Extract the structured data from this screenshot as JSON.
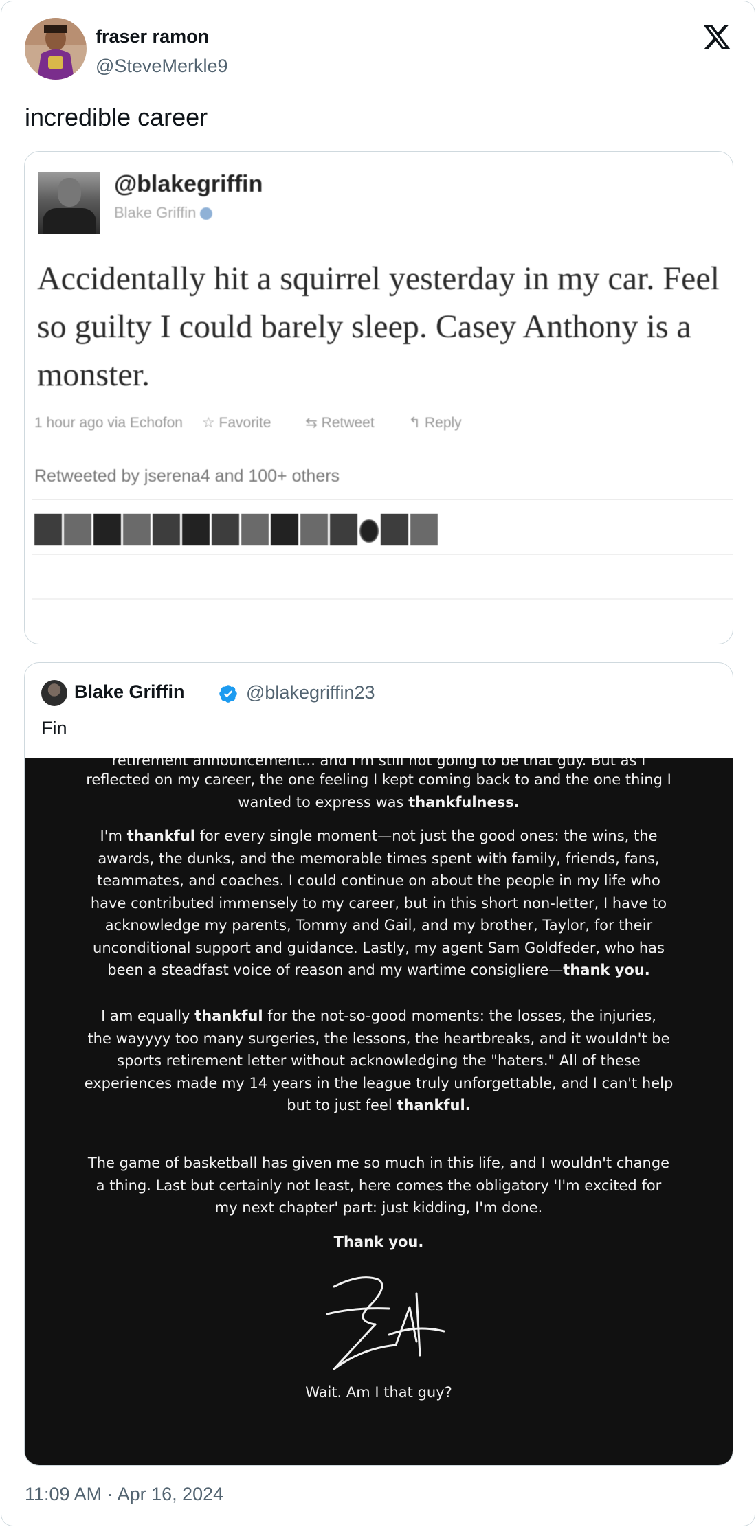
{
  "post": {
    "author_name": "fraser ramon",
    "author_handle": "@SteveMerkle9",
    "text": "incredible career",
    "timestamp": "11:09 AM · Apr 16, 2024"
  },
  "embedded_image": {
    "handle": "@blakegriffin",
    "name": "Blake Griffin",
    "text": "Accidentally hit a squirrel yesterday in my car. Feel so guilty I could barely sleep. Casey Anthony is a monster.",
    "meta_time": "1 hour ago via Echofon",
    "meta_favorite": "Favorite",
    "meta_retweet": "Retweet",
    "meta_reply": "Reply",
    "retweeted_by": "Retweeted by jserena4 and 100+ others"
  },
  "quote": {
    "name": "Blake Griffin",
    "handle": "@blakegriffin23",
    "text": "Fin"
  },
  "letter": {
    "cut_line": "retirement announcement... and I'm still not going to be that guy. But as I",
    "p1_a": "reflected on my career, the one feeling I kept coming back to and the one thing I",
    "p1_b": "wanted to express was ",
    "p1_bold": "thankfulness.",
    "p2_a": "I'm ",
    "p2_bold1": "thankful",
    "p2_b": " for every single moment—not just the good ones: the wins, the",
    "p2_c": "awards, the dunks, and the memorable times spent with family, friends, fans,",
    "p2_d": "teammates, and coaches. I could continue on about the people in my life who",
    "p2_e": "have contributed immensely to my career, but in this short non-letter, I have to",
    "p2_f": "acknowledge my parents, Tommy and Gail, and my brother, Taylor, for their",
    "p2_g": "unconditional support and guidance. Lastly, my agent Sam Goldfeder, who has",
    "p2_h": "been a steadfast voice of reason and my wartime consigliere—",
    "p2_bold2": "thank you.",
    "p3_a": "I am equally ",
    "p3_bold1": "thankful",
    "p3_b": " for the not-so-good moments: the losses, the injuries,",
    "p3_c": "the wayyyy too many surgeries, the lessons, the heartbreaks, and it wouldn't be",
    "p3_d": "sports retirement letter without acknowledging the \"haters.\" All of these",
    "p3_e": "experiences made my 14 years in the league truly unforgettable, and I can't help",
    "p3_f": "but to just feel ",
    "p3_bold2": "thankful.",
    "p4_a": "The game of basketball has given me so much in this life, and I wouldn't change",
    "p4_b": "a thing.  Last but certainly not least, here comes the obligatory 'I'm excited for",
    "p4_c": "my next chapter' part: just kidding, I'm done.",
    "p5": "Thank you.",
    "closing": "Wait. Am I that guy?"
  },
  "colors": {
    "text_primary": "#0f1419",
    "text_secondary": "#536471",
    "border": "#cfd9de",
    "verified_blue": "#1d9bf0",
    "letter_bg": "#111111"
  },
  "icons": {
    "brand": "x-logo-icon",
    "verified": "verified-badge-icon"
  }
}
